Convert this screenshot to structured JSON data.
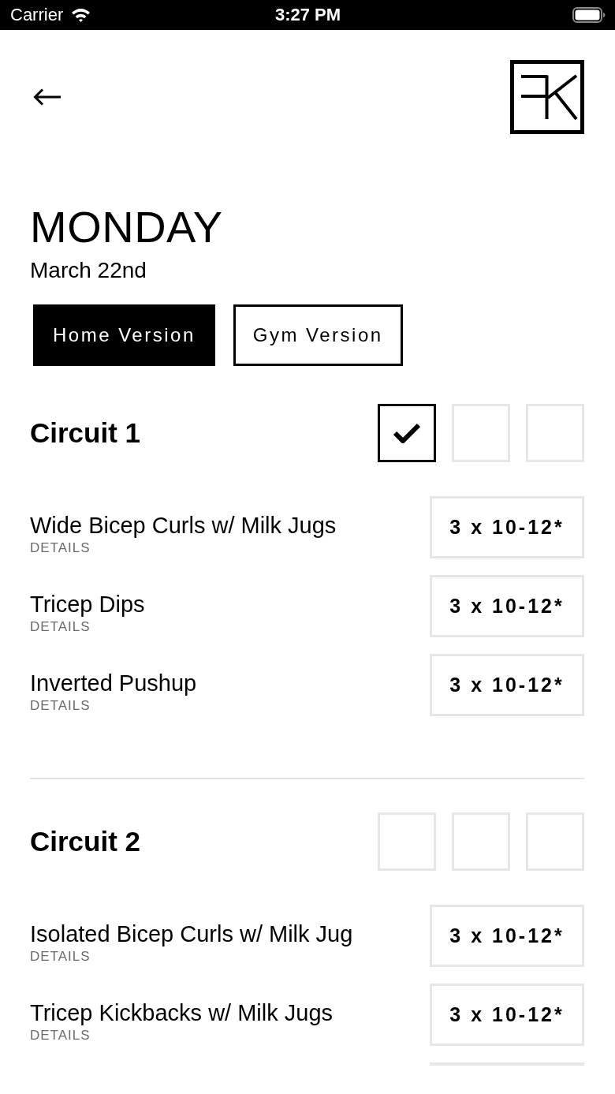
{
  "status_bar": {
    "carrier": "Carrier",
    "time": "3:27 PM"
  },
  "day": {
    "title": "MONDAY",
    "date": "March 22nd"
  },
  "versions": [
    {
      "label": "Home Version",
      "selected": true
    },
    {
      "label": "Gym Version",
      "selected": false
    }
  ],
  "circuits": [
    {
      "title": "Circuit 1",
      "rounds": [
        {
          "checked": true
        },
        {
          "checked": false
        },
        {
          "checked": false
        }
      ],
      "exercises": [
        {
          "name": "Wide Bicep Curls w/ Milk Jugs",
          "details": "DETAILS",
          "reps": "3 x 10-12*"
        },
        {
          "name": "Tricep Dips",
          "details": "DETAILS",
          "reps": "3 x 10-12*"
        },
        {
          "name": "Inverted Pushup",
          "details": "DETAILS",
          "reps": "3 x 10-12*"
        }
      ]
    },
    {
      "title": "Circuit 2",
      "rounds": [
        {
          "checked": false
        },
        {
          "checked": false
        },
        {
          "checked": false
        }
      ],
      "exercises": [
        {
          "name": "Isolated Bicep Curls w/ Milk Jug",
          "details": "DETAILS",
          "reps": "3 x 10-12*"
        },
        {
          "name": "Tricep Kickbacks w/ Milk Jugs",
          "details": "DETAILS",
          "reps": "3 x 10-12*"
        }
      ],
      "more_below": true
    }
  ]
}
